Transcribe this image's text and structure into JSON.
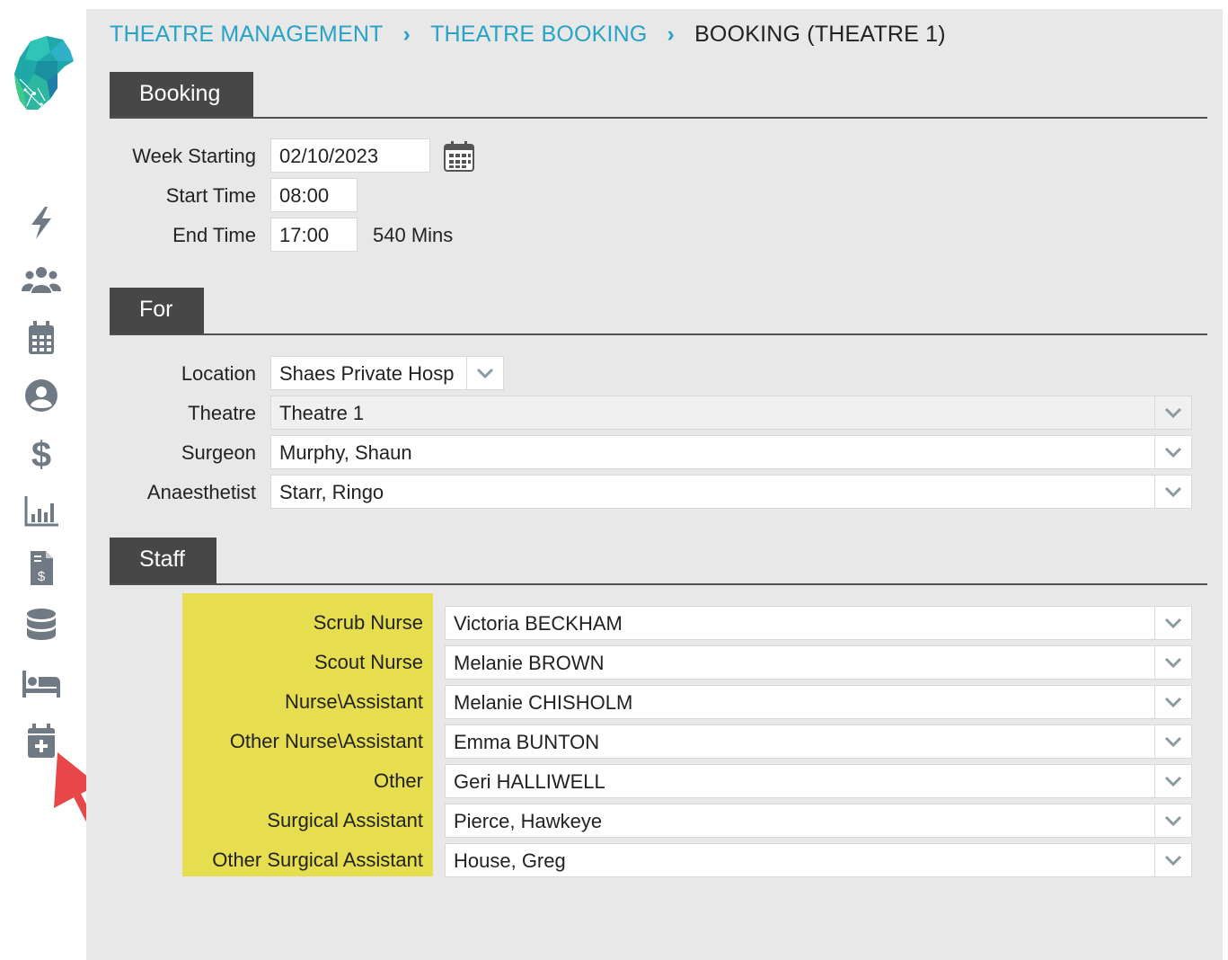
{
  "breadcrumb": {
    "items": [
      "THEATRE MANAGEMENT",
      "THEATRE BOOKING"
    ],
    "current": "BOOKING (THEATRE 1)",
    "separator": "›"
  },
  "sections": {
    "booking": "Booking",
    "for": "For",
    "staff": "Staff"
  },
  "booking": {
    "week_starting_label": "Week Starting",
    "week_starting_value": "02/10/2023",
    "start_time_label": "Start Time",
    "start_time_value": "08:00",
    "end_time_label": "End Time",
    "end_time_value": "17:00",
    "duration": "540 Mins"
  },
  "for": {
    "location_label": "Location",
    "location_value": "Shaes Private Hosp",
    "theatre_label": "Theatre",
    "theatre_value": "Theatre 1",
    "surgeon_label": "Surgeon",
    "surgeon_value": "Murphy, Shaun",
    "anaesthetist_label": "Anaesthetist",
    "anaesthetist_value": "Starr, Ringo"
  },
  "staff": [
    {
      "label": "Scrub Nurse",
      "value": "Victoria BECKHAM"
    },
    {
      "label": "Scout Nurse",
      "value": "Melanie BROWN"
    },
    {
      "label": "Nurse\\Assistant",
      "value": "Melanie CHISHOLM"
    },
    {
      "label": "Other Nurse\\Assistant",
      "value": "Emma BUNTON"
    },
    {
      "label": "Other",
      "value": "Geri HALLIWELL"
    },
    {
      "label": "Surgical Assistant",
      "value": "Pierce, Hawkeye"
    },
    {
      "label": "Other Surgical Assistant",
      "value": "House, Greg"
    }
  ],
  "sidebar_icons": [
    "lightning-icon",
    "users-icon",
    "calendar-icon",
    "user-circle-icon",
    "dollar-icon",
    "bar-chart-icon",
    "invoice-icon",
    "database-icon",
    "bed-icon",
    "calendar-plus-icon"
  ],
  "colors": {
    "accent": "#27a2c8",
    "section_header": "#474747",
    "highlight": "#e6de4e",
    "annotation_arrow": "#e8474a",
    "sidebar_icon": "#707a84"
  }
}
